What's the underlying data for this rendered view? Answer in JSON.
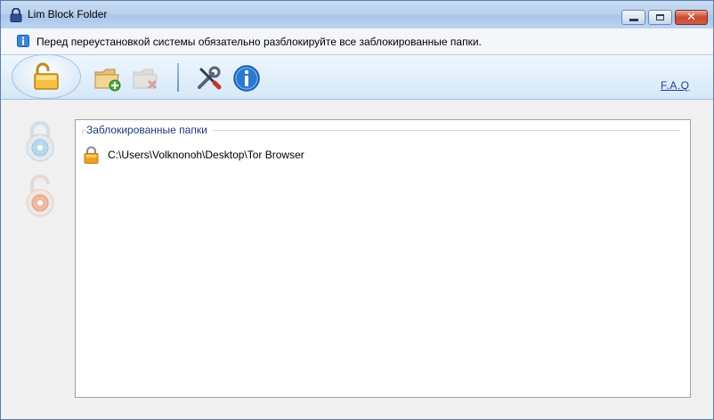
{
  "window": {
    "title": "Lim Block Folder"
  },
  "info": {
    "message": "Перед переустановкой системы обязательно разблокируйте все заблокированные папки."
  },
  "toolbar": {
    "icons": [
      "unlocked-lock-icon",
      "folder-add-icon",
      "folder-remove-icon",
      "tools-icon",
      "info-icon"
    ],
    "faq_label": "F.A.Q"
  },
  "side": {
    "icons": [
      "lock-blue-icon",
      "unlock-orange-icon"
    ]
  },
  "folders": {
    "group_title": "Заблокированные папки",
    "items": [
      {
        "path": "C:\\Users\\Volknonoh\\Desktop\\Tor Browser",
        "icon": "padlock-icon"
      }
    ]
  },
  "colors": {
    "titlebar": "#b9d1ee",
    "toolbar": "#d6e8f8",
    "link": "#1b3f8f",
    "close": "#c94a32"
  }
}
